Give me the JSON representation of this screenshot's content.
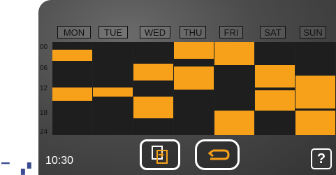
{
  "days": [
    "MON",
    "TUE",
    "WED",
    "THU",
    "FRI",
    "SAT",
    "SUN"
  ],
  "hour_labels": [
    "00",
    "06",
    "12",
    "18",
    "24"
  ],
  "schedule": [
    [
      [
        0.08,
        0.2
      ],
      [
        0.49,
        0.63
      ]
    ],
    [
      [
        0.49,
        0.59
      ]
    ],
    [
      [
        0.23,
        0.41
      ],
      [
        0.59,
        0.82
      ]
    ],
    [
      [
        0.0,
        0.18
      ],
      [
        0.26,
        0.51
      ]
    ],
    [
      [
        0.0,
        0.25
      ],
      [
        0.74,
        1.0
      ]
    ],
    [
      [
        0.25,
        0.49
      ],
      [
        0.52,
        0.74
      ]
    ],
    [
      [
        0.36,
        0.71
      ],
      [
        0.74,
        1.0
      ]
    ]
  ],
  "clock": "10:30",
  "buttons": {
    "copy_icon": "copy-icon",
    "back_icon": "back-arrow-icon",
    "help": "?"
  },
  "colors": {
    "on": "#f7a11a",
    "off": "#1e1e1e",
    "frame": "#444444"
  }
}
